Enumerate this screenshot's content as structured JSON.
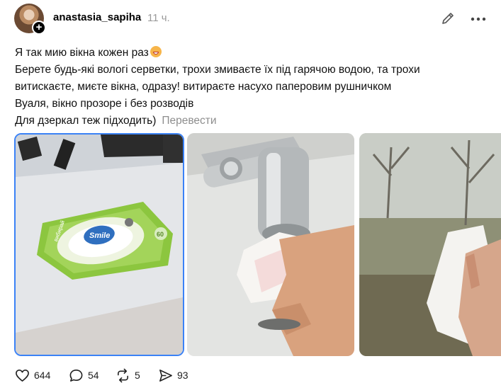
{
  "post": {
    "username": "anastasia_sapiha",
    "time": "11 ч.",
    "lines": [
      "Я так мию вікна кожен раз",
      "Берете будь-які вологі серветки, трохи змиваєте їх під гарячою водою, та трохи",
      "витискаєте, миєте вікна, одразу! витираєте насухо паперовим рушничком",
      "Вуаля, вікно прозоре і без розводів",
      "Для дзеркал теж підходить)"
    ],
    "translate_label": "Перевести",
    "package_brand": "Smile",
    "package_text": "вибирай",
    "package_count": "60"
  },
  "actions": {
    "likes": "644",
    "comments": "54",
    "reposts": "5",
    "shares": "93"
  },
  "icons": [
    "edit-icon",
    "more-icon",
    "heart-icon",
    "comment-icon",
    "repost-icon",
    "share-icon"
  ],
  "colors": {
    "selected_border": "#3b82f6",
    "muted_text": "#8e8e8e"
  }
}
